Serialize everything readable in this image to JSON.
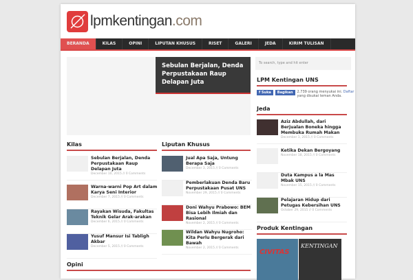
{
  "site": {
    "name": "lpmkentingan",
    "tld": ".com"
  },
  "nav": [
    "BERANDA",
    "KILAS",
    "OPINI",
    "LIPUTAN KHUSUS",
    "RISET",
    "GALERI",
    "JEDA",
    "KIRIM TULISAN"
  ],
  "featured": {
    "title": "Sebulan Berjalan, Denda Perpustakaan Raup Delapan Juta"
  },
  "search": {
    "placeholder": "To search, type and hit enter"
  },
  "kilas": {
    "heading": "Kilas",
    "items": [
      {
        "title": "Sebulan Berjalan, Denda Perpustakaan Raup Delapan Juta",
        "meta": "December 10, 2015 // 0 Comments"
      },
      {
        "title": "Warna-warni Pop Art dalam Karya Seni Interior",
        "meta": "December 7, 2015 // 0 Comments"
      },
      {
        "title": "Rayakan Wisuda, Fakultas Teknik Gelar Arak-arakan",
        "meta": "December 6, 2015 // 0 Comments"
      },
      {
        "title": "Yusuf Mansur Isi Tabligh Akbar",
        "meta": "December 5, 2015 // 0 Comments"
      }
    ]
  },
  "liputan": {
    "heading": "Liputan Khusus",
    "items": [
      {
        "title": "Jual Apa Saja, Untung Berapa Saja",
        "meta": "December 3, 2015 // 0 Comments"
      },
      {
        "title": "Pemberlakuan Denda Baru Perpustakaan Pusat UNS",
        "meta": "November 29, 2015 // 0 Comments"
      },
      {
        "title": "Doni Wahyu Prabowo: BEM Bisa Lebih Ilmiah dan Rasional",
        "meta": "November 2, 2015 // 0 Comments"
      },
      {
        "title": "Wildan Wahyu Nugroho: Kita Perlu Bergerak dari Bawah",
        "meta": "November 2, 2015 // 0 Comments"
      }
    ]
  },
  "opini": {
    "heading": "Opini"
  },
  "fbwidget": {
    "heading": "LPM Kentingan UNS",
    "button1": "f Suka",
    "button2": "Bagikan",
    "text": "2.739 orang menyukai ini.",
    "link": "Daftar",
    "text2": "yang disukai teman Anda."
  },
  "jeda": {
    "heading": "Jeda",
    "items": [
      {
        "title": "Aziz Abdullah, dari Berjualan Boneka hingga Membuka Rumah Makan",
        "meta": "December 1, 2015 // 0 Comments"
      },
      {
        "title": "Ketika Dekan Bergoyang",
        "meta": "November 18, 2015 // 0 Comments"
      },
      {
        "title": "Duta Kampus a la Mas Mbak UNS",
        "meta": "November 15, 2015 // 0 Comments"
      },
      {
        "title": "Pelajaran Hidup dari Petugas Kebersihan UNS",
        "meta": "October 29, 2015 // 0 Comments"
      }
    ]
  },
  "produk": {
    "heading": "Produk Kentingan",
    "cover1": "CIVITAS",
    "cover2": "KENTINGAN"
  },
  "colors": {
    "accent": "#d94646",
    "nav": "#2a2a2a"
  }
}
